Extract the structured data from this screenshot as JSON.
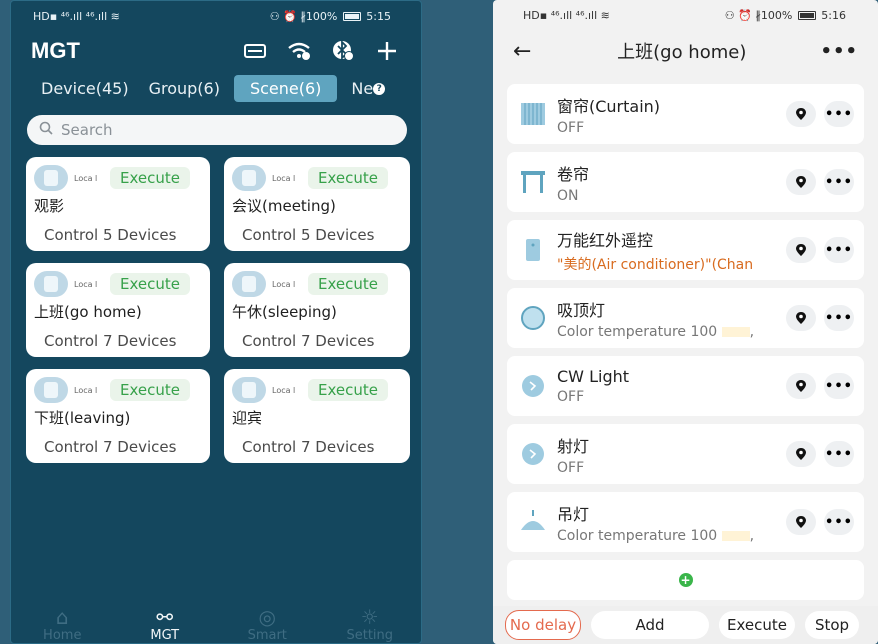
{
  "left": {
    "status_bar": {
      "left": "HD▪ ⁴⁶.ıll ⁴⁶.ıll ≋",
      "right": "⚇ ⏰ ∦100%",
      "time": "5:15"
    },
    "app_title": "MGT",
    "tabs": [
      {
        "label": "Device(45)"
      },
      {
        "label": "Group(6)"
      },
      {
        "label": "Scene(6)"
      },
      {
        "label": "Ne"
      }
    ],
    "search": {
      "placeholder": "Search"
    },
    "scenes": [
      {
        "tag": "Loca l",
        "execute": "Execute",
        "name": "观影",
        "control": "Control 5 Devices"
      },
      {
        "tag": "Loca l",
        "execute": "Execute",
        "name": "会议(meeting)",
        "control": "Control 5 Devices"
      },
      {
        "tag": "Loca l",
        "execute": "Execute",
        "name": "上班(go home)",
        "control": "Control 7 Devices"
      },
      {
        "tag": "Loca l",
        "execute": "Execute",
        "name": "午休(sleeping)",
        "control": "Control 7 Devices"
      },
      {
        "tag": "Loca l",
        "execute": "Execute",
        "name": "下班(leaving)",
        "control": "Control 7 Devices"
      },
      {
        "tag": "Loca l",
        "execute": "Execute",
        "name": "迎宾",
        "control": "Control 7 Devices"
      }
    ],
    "nav": [
      {
        "label": "Home",
        "icon": "home-icon",
        "glyph": "⌂"
      },
      {
        "label": "MGT",
        "icon": "share-nodes-icon",
        "glyph": "⚯"
      },
      {
        "label": "Smart",
        "icon": "compass-icon",
        "glyph": "◎"
      },
      {
        "label": "Setting",
        "icon": "gear-icon",
        "glyph": "☼"
      }
    ],
    "colors": {
      "background": "#14475e",
      "active_tab": "#5fa4bf",
      "execute_text": "#37a14a"
    }
  },
  "right": {
    "status_bar": {
      "left": "HD▪ ⁴⁶.ıll ⁴⁶.ıll ≋",
      "right": "⚇ ⏰ ∦100%",
      "time": "5:16"
    },
    "title": "上班(go home)",
    "back": "←",
    "more": "•••",
    "devices": [
      {
        "name": "窗帘(Curtain)",
        "status": "OFF",
        "icon": "curtain-icon",
        "status_color": "normal"
      },
      {
        "name": "卷帘",
        "status": "ON",
        "icon": "roller-blind-icon",
        "status_color": "normal"
      },
      {
        "name": "万能红外遥控",
        "status": "\"美的(Air conditioner)\"(Chan",
        "icon": "remote-icon",
        "status_color": "orange"
      },
      {
        "name": "吸顶灯",
        "status": "Color temperature 100",
        "suffix": ",",
        "icon": "ceiling-light-icon",
        "status_color": "normal"
      },
      {
        "name": "CW Light",
        "status": "OFF",
        "icon": "bulb-icon",
        "status_color": "normal"
      },
      {
        "name": "射灯",
        "status": "OFF",
        "icon": "spotlight-icon",
        "status_color": "normal"
      },
      {
        "name": "吊灯",
        "status": "Color temperature 100",
        "suffix": ",",
        "icon": "pendant-light-icon",
        "status_color": "normal"
      }
    ],
    "add_plus": "+",
    "buttons": {
      "no_delay": "No delay",
      "add": "Add",
      "execute": "Execute",
      "stop": "Stop"
    },
    "colors": {
      "no_delay": "#e46a4e",
      "add_plus": "#3ab54a",
      "status_orange": "#d86b1f"
    }
  }
}
